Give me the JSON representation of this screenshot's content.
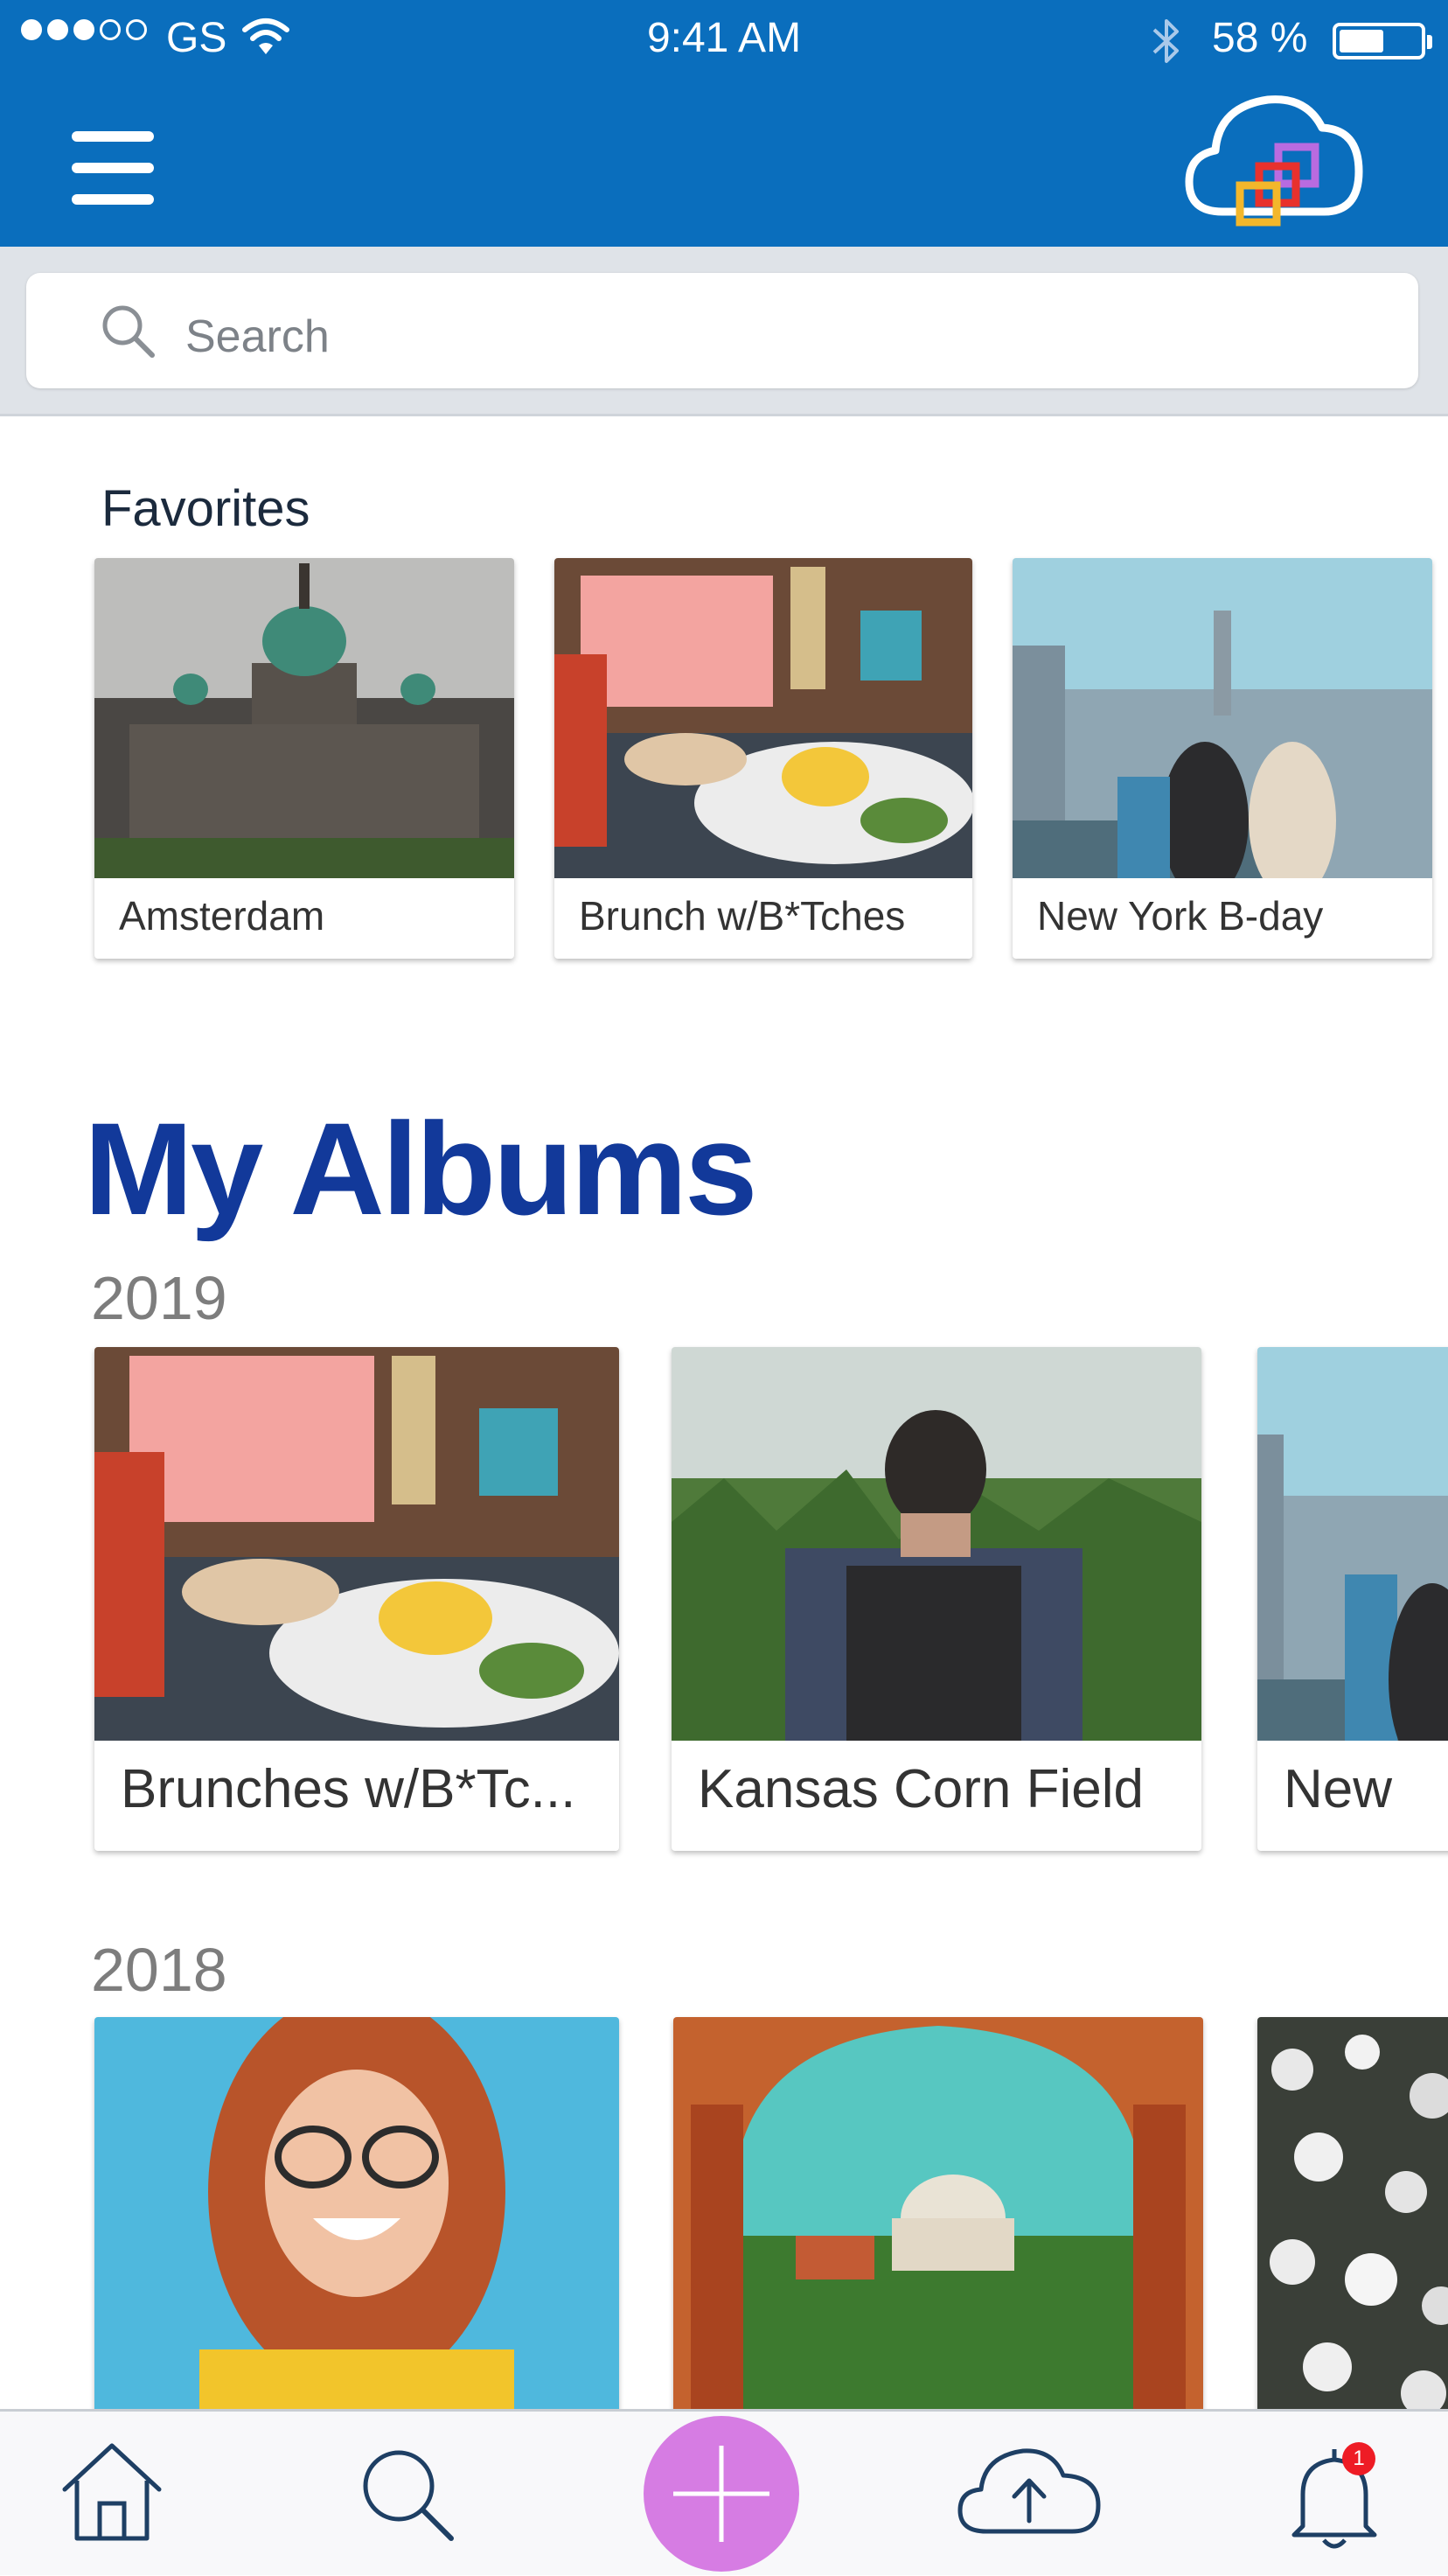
{
  "status_bar": {
    "carrier": "GS",
    "time": "9:41 AM",
    "battery_percent": "58 %",
    "battery_level": 0.55
  },
  "search": {
    "placeholder": "Search"
  },
  "favorites": {
    "title": "Favorites",
    "items": [
      {
        "label": "Amsterdam"
      },
      {
        "label": "Brunch w/B*Tches"
      },
      {
        "label": "New York  B-day"
      }
    ]
  },
  "albums": {
    "title": "My Albums",
    "groups": [
      {
        "year": "2019",
        "items": [
          {
            "label": "Brunches w/B*Tc..."
          },
          {
            "label": "Kansas Corn Field"
          },
          {
            "label": "New"
          }
        ]
      },
      {
        "year": "2018"
      }
    ]
  },
  "notifications": {
    "badge_count": "1"
  },
  "colors": {
    "header": "#0a6ebd",
    "albums_title": "#12399a",
    "add_button": "#d67ce3",
    "badge": "#ee1c25"
  }
}
